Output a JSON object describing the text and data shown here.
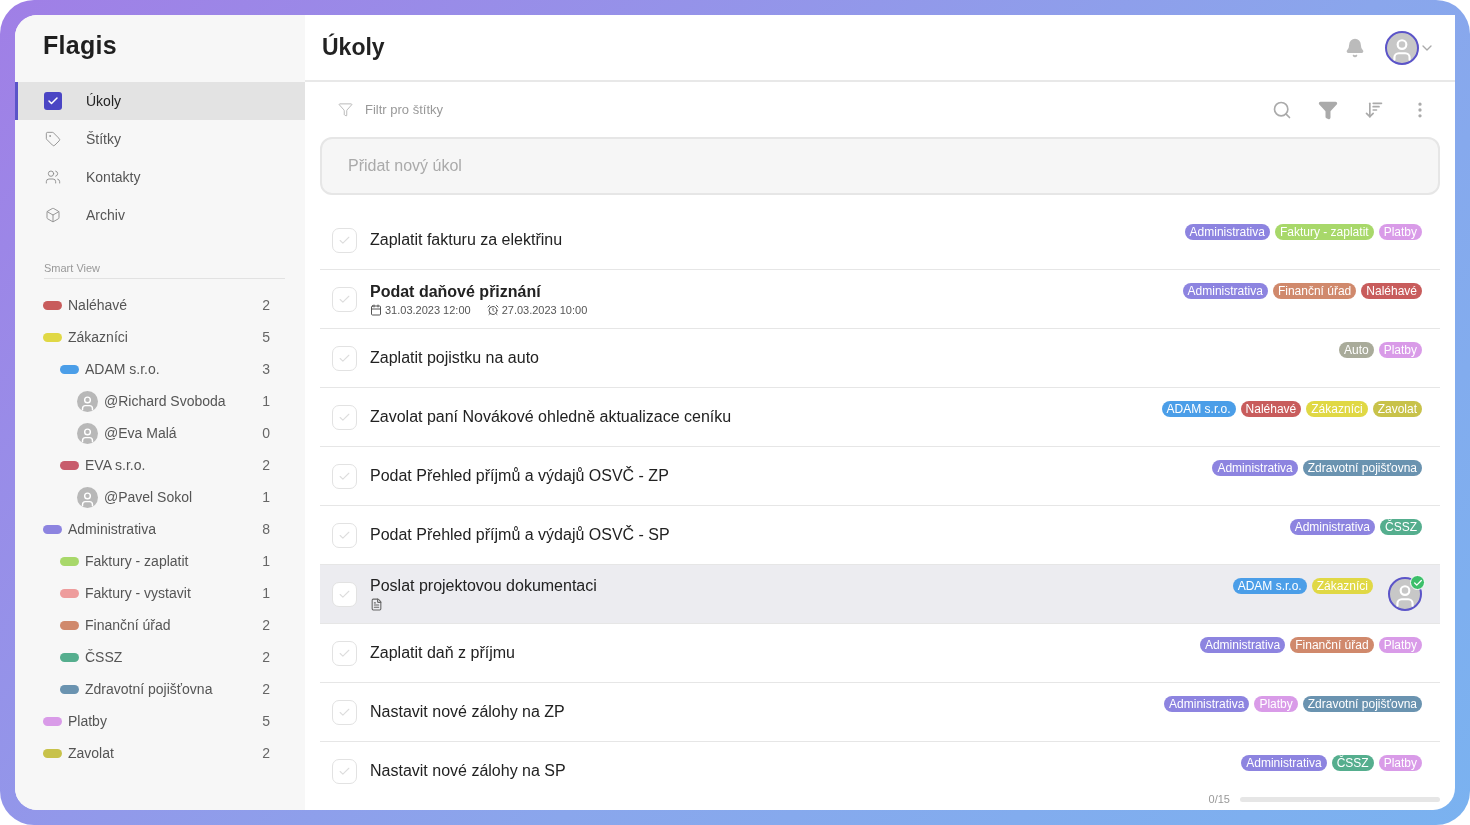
{
  "app": {
    "logo": "Flagis"
  },
  "nav": [
    {
      "label": "Úkoly",
      "selected": true
    },
    {
      "label": "Štítky",
      "selected": false
    },
    {
      "label": "Kontakty",
      "selected": false
    },
    {
      "label": "Archiv",
      "selected": false
    }
  ],
  "smart_view": {
    "heading": "Smart View",
    "items": [
      {
        "kind": "tag",
        "label": "Naléhavé",
        "count": "2",
        "color": "#c85c5c"
      },
      {
        "kind": "tag",
        "label": "Zákazníci",
        "count": "5",
        "color": "#e0d845",
        "children": [
          {
            "kind": "tag",
            "label": "ADAM s.r.o.",
            "count": "3",
            "color": "#4b9ee8",
            "children": [
              {
                "kind": "person",
                "label": "@Richard Svoboda",
                "count": "1"
              },
              {
                "kind": "person",
                "label": "@Eva Malá",
                "count": "0"
              }
            ]
          },
          {
            "kind": "tag",
            "label": "EVA s.r.o.",
            "count": "2",
            "color": "#c85c6c",
            "children": [
              {
                "kind": "person",
                "label": "@Pavel Sokol",
                "count": "1"
              }
            ]
          }
        ]
      },
      {
        "kind": "tag",
        "label": "Administrativa",
        "count": "8",
        "color": "#8d84e0",
        "children": [
          {
            "kind": "tag",
            "label": "Faktury - zaplatit",
            "count": "1",
            "color": "#a8d86a"
          },
          {
            "kind": "tag",
            "label": "Faktury - vystavit",
            "count": "1",
            "color": "#ee9c9c"
          },
          {
            "kind": "tag",
            "label": "Finanční úřad",
            "count": "2",
            "color": "#d0896c"
          },
          {
            "kind": "tag",
            "label": "ČSSZ",
            "count": "2",
            "color": "#55ae8e"
          },
          {
            "kind": "tag",
            "label": "Zdravotní pojišťovna",
            "count": "2",
            "color": "#6a93b0"
          }
        ]
      },
      {
        "kind": "tag",
        "label": "Platby",
        "count": "5",
        "color": "#d99be8"
      },
      {
        "kind": "tag",
        "label": "Zavolat",
        "count": "2",
        "color": "#c8c24a"
      }
    ]
  },
  "header": {
    "title": "Úkoly"
  },
  "toolbar": {
    "filter_placeholder": "Filtr pro štítky"
  },
  "new_task": {
    "placeholder": "Přidat nový úkol"
  },
  "tasks": [
    {
      "title": "Zaplatit fakturu za elektřinu",
      "done": false,
      "selected": false,
      "bold": false,
      "tags": [
        {
          "label": "Administrativa",
          "color": "#8d84e0"
        },
        {
          "label": "Faktury - zaplatit",
          "color": "#a8d86a"
        },
        {
          "label": "Platby",
          "color": "#d99be8"
        }
      ]
    },
    {
      "title": "Podat daňové přiznání",
      "done": false,
      "selected": false,
      "bold": true,
      "dates": [
        {
          "kind": "due",
          "text": "31.03.2023 12:00"
        },
        {
          "kind": "reminder",
          "text": "27.03.2023 10:00"
        }
      ],
      "tags": [
        {
          "label": "Administrativa",
          "color": "#8d84e0"
        },
        {
          "label": "Finanční úřad",
          "color": "#d0896c"
        },
        {
          "label": "Naléhavé",
          "color": "#c85c5c"
        }
      ]
    },
    {
      "title": "Zaplatit pojistku na auto",
      "done": false,
      "selected": false,
      "bold": false,
      "tags": [
        {
          "label": "Auto",
          "color": "#a9ab9a"
        },
        {
          "label": "Platby",
          "color": "#d99be8"
        }
      ]
    },
    {
      "title": "Zavolat paní Novákové ohledně aktualizace ceníku",
      "done": false,
      "selected": false,
      "bold": false,
      "tags": [
        {
          "label": "ADAM s.r.o.",
          "color": "#4b9ee8"
        },
        {
          "label": "Naléhavé",
          "color": "#c85c5c"
        },
        {
          "label": "Zákazníci",
          "color": "#e0d845"
        },
        {
          "label": "Zavolat",
          "color": "#c8c24a"
        }
      ]
    },
    {
      "title": "Podat Přehled příjmů a výdajů OSVČ - ZP",
      "done": false,
      "selected": false,
      "bold": false,
      "tags": [
        {
          "label": "Administrativa",
          "color": "#8d84e0"
        },
        {
          "label": "Zdravotní pojišťovna",
          "color": "#6a93b0"
        }
      ]
    },
    {
      "title": "Podat Přehled příjmů a výdajů OSVČ - SP",
      "done": false,
      "selected": false,
      "bold": false,
      "tags": [
        {
          "label": "Administrativa",
          "color": "#8d84e0"
        },
        {
          "label": "ČSSZ",
          "color": "#55ae8e"
        }
      ]
    },
    {
      "title": "Poslat projektovou dokumentaci",
      "done": false,
      "selected": true,
      "bold": false,
      "has_note": true,
      "assignee": {
        "accepted": true
      },
      "tags": [
        {
          "label": "ADAM s.r.o.",
          "color": "#4b9ee8"
        },
        {
          "label": "Zákazníci",
          "color": "#e0d845"
        }
      ]
    },
    {
      "title": "Zaplatit daň z příjmu",
      "done": false,
      "selected": false,
      "bold": false,
      "tags": [
        {
          "label": "Administrativa",
          "color": "#8d84e0"
        },
        {
          "label": "Finanční úřad",
          "color": "#d0896c"
        },
        {
          "label": "Platby",
          "color": "#d99be8"
        }
      ]
    },
    {
      "title": "Nastavit nové zálohy na ZP",
      "done": false,
      "selected": false,
      "bold": false,
      "tags": [
        {
          "label": "Administrativa",
          "color": "#8d84e0"
        },
        {
          "label": "Platby",
          "color": "#d99be8"
        },
        {
          "label": "Zdravotní pojišťovna",
          "color": "#6a93b0"
        }
      ]
    },
    {
      "title": "Nastavit nové zálohy na SP",
      "done": false,
      "selected": false,
      "bold": false,
      "tags": [
        {
          "label": "Administrativa",
          "color": "#8d84e0"
        },
        {
          "label": "ČSSZ",
          "color": "#55ae8e"
        },
        {
          "label": "Platby",
          "color": "#d99be8"
        }
      ]
    }
  ],
  "progress": {
    "text": "0/15",
    "level": 0
  }
}
